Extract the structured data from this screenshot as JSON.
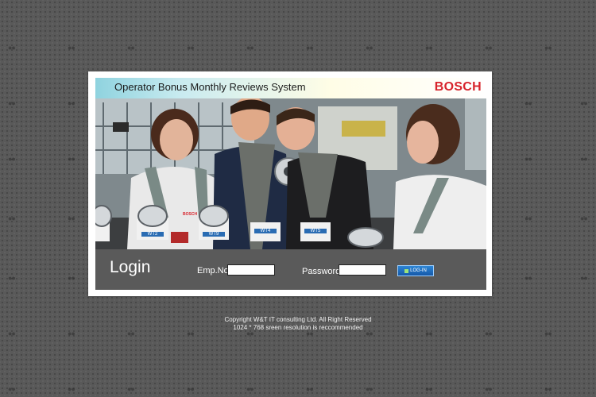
{
  "header": {
    "title": "Operator Bonus Monthly Reviews System",
    "logo": "BOSCH"
  },
  "photo": {
    "labels": [
      "WT2",
      "WT9",
      "WT4",
      "WT5"
    ],
    "shirt_brand": "BOSCH"
  },
  "login": {
    "title": "Login",
    "emp_label": "Emp.No",
    "emp_value": "",
    "password_label": "Password",
    "password_value": "",
    "button_label": "LOG-IN"
  },
  "footer": {
    "copyright": "Copyright W&T IT consulting Ltd. All Right Reserved",
    "resolution_note": "1024 * 768 sreen resolution is reccommended"
  },
  "colors": {
    "background": "#595959",
    "brand_red": "#d7242c",
    "login_bar": "#5a5a5a",
    "button_blue": "#1f6fc3"
  }
}
